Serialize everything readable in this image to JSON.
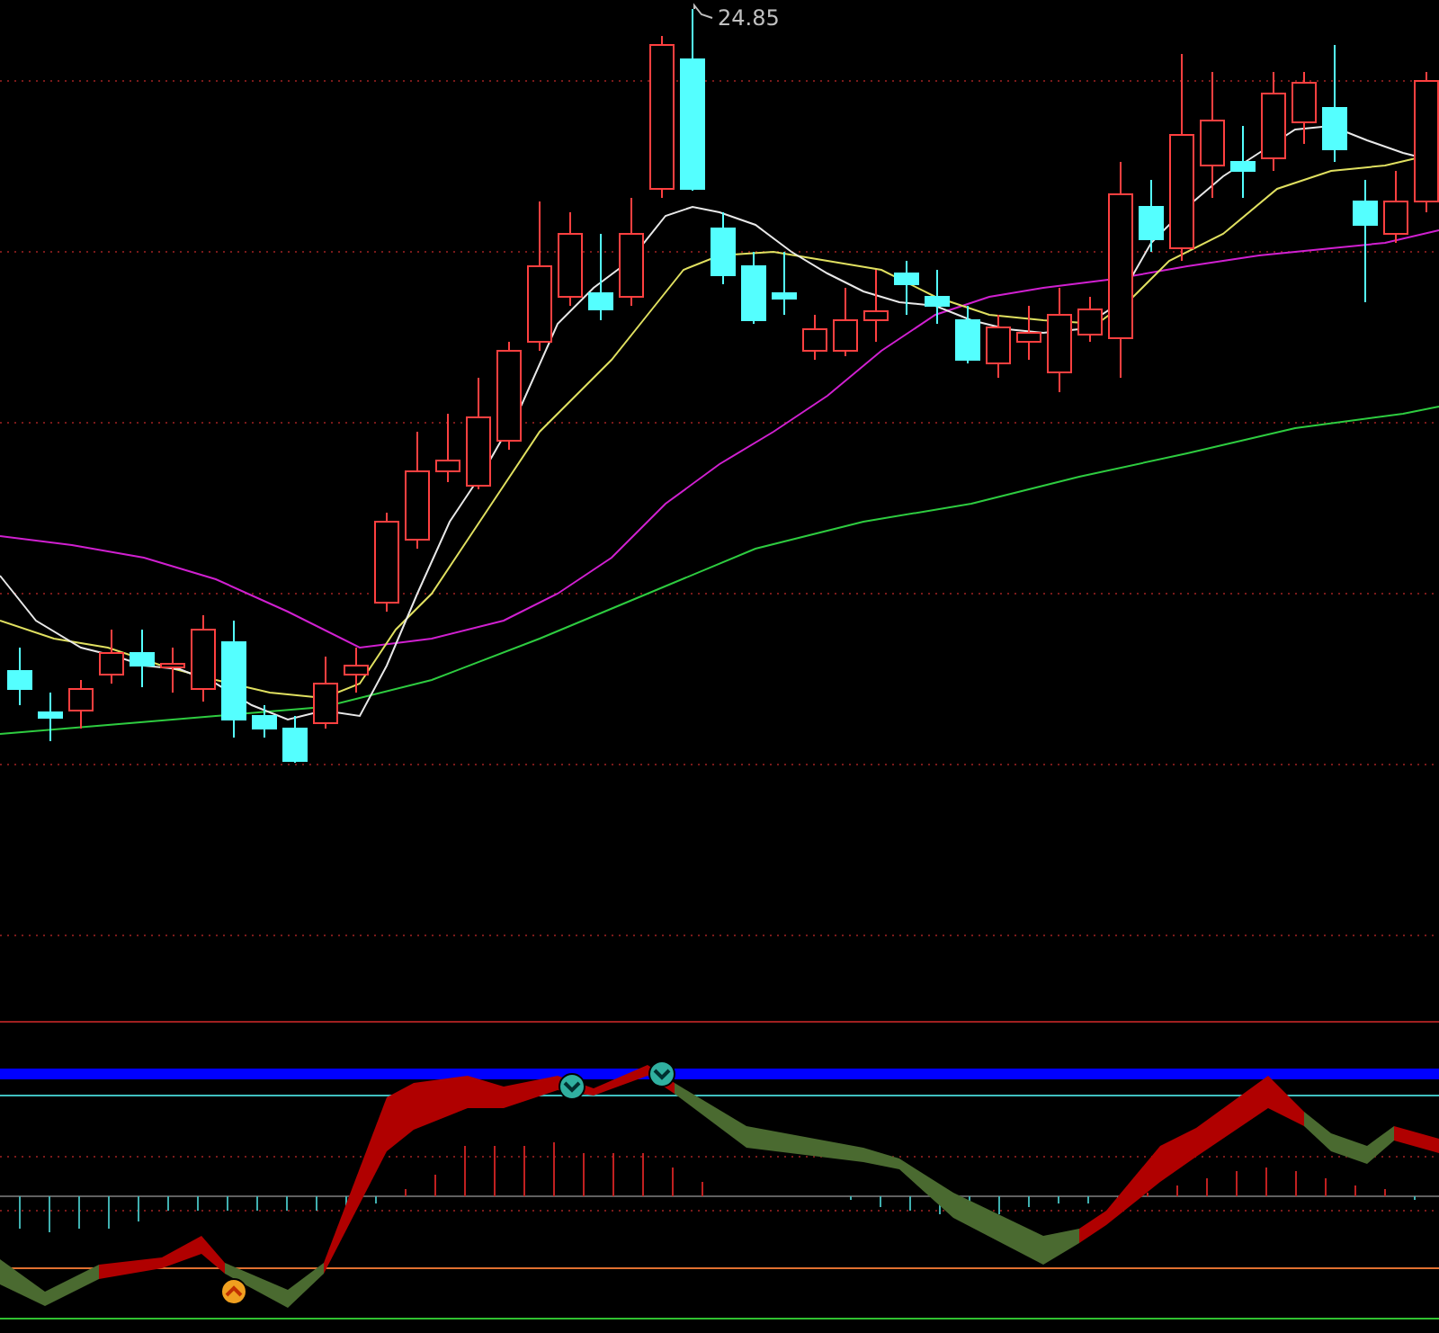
{
  "price_chart": {
    "high_label": "24.85"
  }
}
